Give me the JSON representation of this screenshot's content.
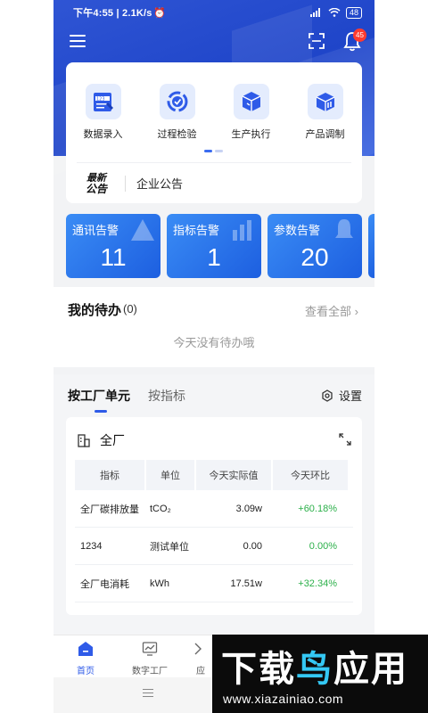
{
  "status_bar": {
    "time": "下午4:55 | 2.1K/s",
    "battery": "48"
  },
  "header": {
    "notification_count": "45"
  },
  "quick_actions": [
    {
      "label": "数据录入",
      "icon": "data-entry-icon"
    },
    {
      "label": "过程检验",
      "icon": "process-inspection-icon"
    },
    {
      "label": "生产执行",
      "icon": "production-execution-icon"
    },
    {
      "label": "产品调制",
      "icon": "product-modulation-icon"
    }
  ],
  "notice": {
    "logo_line1": "最新",
    "logo_line2": "公告",
    "text": "企业公告"
  },
  "alerts": [
    {
      "label": "通讯告警",
      "value": "11"
    },
    {
      "label": "指标告警",
      "value": "1"
    },
    {
      "label": "参数告警",
      "value": "20"
    }
  ],
  "todo": {
    "title": "我的待办",
    "count": "(0)",
    "view_all": "查看全部",
    "empty": "今天没有待办哦"
  },
  "metrics": {
    "tabs": [
      "按工厂单元",
      "按指标"
    ],
    "settings": "设置",
    "card_title": "全厂",
    "columns": [
      "指标",
      "单位",
      "今天实际值",
      "今天环比"
    ],
    "rows": [
      [
        "全厂碳排放量",
        "tCO₂",
        "3.09w",
        "+60.18%"
      ],
      [
        "1234",
        "测试单位",
        "0.00",
        "0.00%"
      ],
      [
        "全厂电消耗",
        "kWh",
        "17.51w",
        "+32.34%"
      ]
    ]
  },
  "bottom_nav": [
    "首页",
    "数字工厂",
    "应"
  ],
  "watermark": {
    "title_a": "下载",
    "title_b": "鸟",
    "title_c": "应用",
    "url": "www.xiazainiao.com"
  },
  "colors": {
    "primary": "#2f5be8",
    "positive": "#2cb04a",
    "alert_bg": "#1d5fe0"
  }
}
